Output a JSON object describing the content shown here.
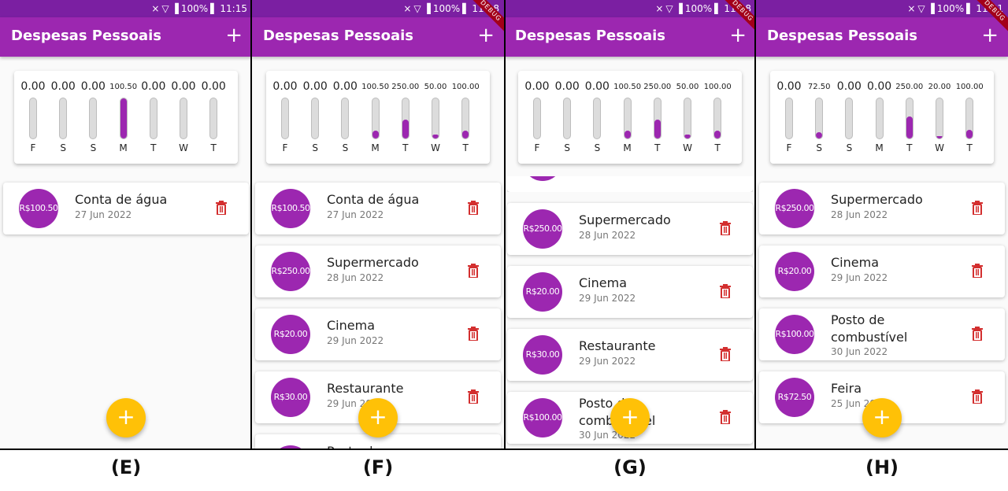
{
  "app_title": "Despesas Pessoais",
  "debug_banner": "DEBUG",
  "add_symbol": "+",
  "colors": {
    "primary": "#9c27b0",
    "status_bar": "#7b1fa2",
    "fab": "#ffc107",
    "delete": "#d32f2f"
  },
  "panels": [
    {
      "label": "(E)",
      "time": "11:15",
      "battery": "100%",
      "chart": [
        {
          "day": "F",
          "amount": "0.00",
          "fraction": 0
        },
        {
          "day": "S",
          "amount": "0.00",
          "fraction": 0
        },
        {
          "day": "S",
          "amount": "0.00",
          "fraction": 0
        },
        {
          "day": "M",
          "amount": "100.50",
          "fraction": 1.0
        },
        {
          "day": "T",
          "amount": "0.00",
          "fraction": 0
        },
        {
          "day": "W",
          "amount": "0.00",
          "fraction": 0
        },
        {
          "day": "T",
          "amount": "0.00",
          "fraction": 0
        }
      ],
      "transactions": [
        {
          "value": "R$100.50",
          "title": "Conta de água",
          "date": "27 Jun 2022"
        }
      ]
    },
    {
      "label": "(F)",
      "time": "11:18",
      "battery": "100%",
      "chart": [
        {
          "day": "F",
          "amount": "0.00",
          "fraction": 0
        },
        {
          "day": "S",
          "amount": "0.00",
          "fraction": 0
        },
        {
          "day": "S",
          "amount": "0.00",
          "fraction": 0
        },
        {
          "day": "M",
          "amount": "100.50",
          "fraction": 0.19
        },
        {
          "day": "T",
          "amount": "250.00",
          "fraction": 0.48
        },
        {
          "day": "W",
          "amount": "50.00",
          "fraction": 0.1
        },
        {
          "day": "T",
          "amount": "100.00",
          "fraction": 0.19
        }
      ],
      "transactions": [
        {
          "value": "R$100.50",
          "title": "Conta de água",
          "date": "27 Jun 2022"
        },
        {
          "value": "R$250.00",
          "title": "Supermercado",
          "date": "28 Jun 2022"
        },
        {
          "value": "R$20.00",
          "title": "Cinema",
          "date": "29 Jun 2022"
        },
        {
          "value": "R$30.00",
          "title": "Restaurante",
          "date": "29 Jun 2022"
        },
        {
          "value": "",
          "title": "Posto de",
          "date": ""
        }
      ]
    },
    {
      "label": "(G)",
      "time": "11:18",
      "battery": "100%",
      "chart": [
        {
          "day": "F",
          "amount": "0.00",
          "fraction": 0
        },
        {
          "day": "S",
          "amount": "0.00",
          "fraction": 0
        },
        {
          "day": "S",
          "amount": "0.00",
          "fraction": 0
        },
        {
          "day": "M",
          "amount": "100.50",
          "fraction": 0.19
        },
        {
          "day": "T",
          "amount": "250.00",
          "fraction": 0.48
        },
        {
          "day": "W",
          "amount": "50.00",
          "fraction": 0.1
        },
        {
          "day": "T",
          "amount": "100.00",
          "fraction": 0.19
        }
      ],
      "transactions": [
        {
          "value": "",
          "title": "",
          "date": ""
        },
        {
          "value": "R$250.00",
          "title": "Supermercado",
          "date": "28 Jun 2022"
        },
        {
          "value": "R$20.00",
          "title": "Cinema",
          "date": "29 Jun 2022"
        },
        {
          "value": "R$30.00",
          "title": "Restaurante",
          "date": "29 Jun 2022"
        },
        {
          "value": "R$100.00",
          "title": "Posto de combustível",
          "date": "30 Jun 2022"
        }
      ]
    },
    {
      "label": "(H)",
      "time": "11:21",
      "battery": "100%",
      "chart": [
        {
          "day": "F",
          "amount": "0.00",
          "fraction": 0
        },
        {
          "day": "S",
          "amount": "72.50",
          "fraction": 0.15
        },
        {
          "day": "S",
          "amount": "0.00",
          "fraction": 0
        },
        {
          "day": "M",
          "amount": "0.00",
          "fraction": 0
        },
        {
          "day": "T",
          "amount": "250.00",
          "fraction": 0.55
        },
        {
          "day": "W",
          "amount": "20.00",
          "fraction": 0.05
        },
        {
          "day": "T",
          "amount": "100.00",
          "fraction": 0.22
        }
      ],
      "transactions": [
        {
          "value": "R$250.00",
          "title": "Supermercado",
          "date": "28 Jun 2022"
        },
        {
          "value": "R$20.00",
          "title": "Cinema",
          "date": "29 Jun 2022"
        },
        {
          "value": "R$100.00",
          "title": "Posto de combustível",
          "date": "30 Jun 2022"
        },
        {
          "value": "R$72.50",
          "title": "Feira",
          "date": "25 Jun 2022"
        }
      ]
    }
  ]
}
